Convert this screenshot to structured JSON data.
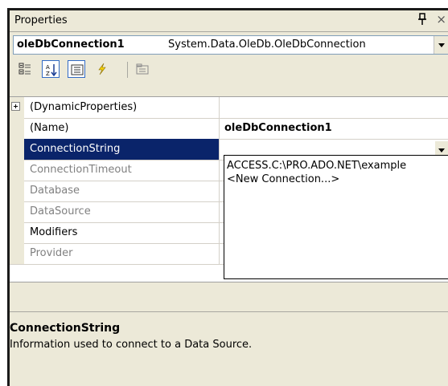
{
  "window": {
    "title": "Properties"
  },
  "object_selector": {
    "name": "oleDbConnection1",
    "type": "System.Data.OleDb.OleDbConnection"
  },
  "toolbar": {
    "buttons": [
      {
        "icon": "categorized-icon"
      },
      {
        "icon": "alphabetical-icon",
        "active": true
      },
      {
        "icon": "properties-icon"
      },
      {
        "icon": "events-icon"
      },
      {
        "icon": "property-pages-icon"
      }
    ]
  },
  "properties": [
    {
      "name": "(DynamicProperties)",
      "value": "",
      "expandable": true
    },
    {
      "name": "(Name)",
      "value": "oleDbConnection1",
      "bold_value": true
    },
    {
      "name": "ConnectionString",
      "value": "",
      "selected": true
    },
    {
      "name": "ConnectionTimeout",
      "value": "",
      "readonly": true
    },
    {
      "name": "Database",
      "value": "",
      "readonly": true
    },
    {
      "name": "DataSource",
      "value": "",
      "readonly": true
    },
    {
      "name": "Modifiers",
      "value": ""
    },
    {
      "name": "Provider",
      "value": "",
      "readonly": true
    }
  ],
  "connection_dropdown": {
    "items": [
      "ACCESS.C:\\PRO.ADO.NET\\example",
      "<New Connection...>"
    ]
  },
  "description": {
    "title": "ConnectionString",
    "text": "Information used to connect to a Data Source."
  },
  "colors": {
    "selection": "#0a246a",
    "panel": "#ece9d8",
    "readonly_text": "#808080"
  }
}
